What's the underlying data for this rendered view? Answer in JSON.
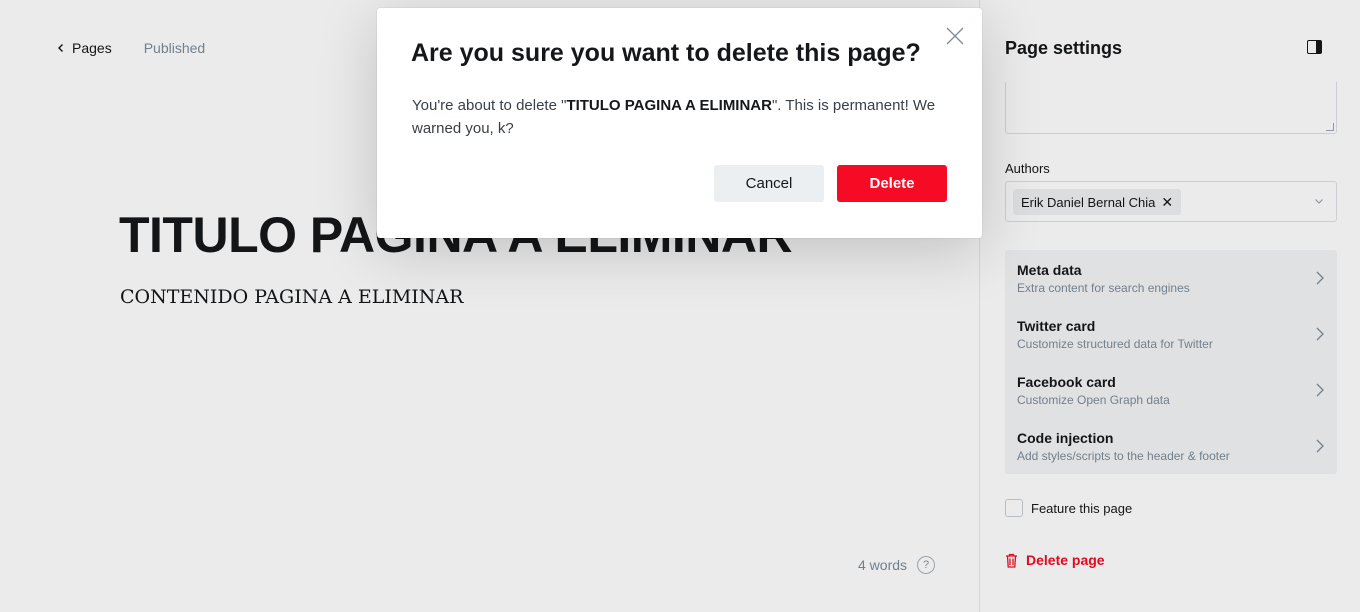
{
  "editor": {
    "back_label": "Pages",
    "status": "Published",
    "title": "TITULO PAGINA A ELIMINAR",
    "body": "CONTENIDO PAGINA A ELIMINAR",
    "word_count": "4 words",
    "help_glyph": "?"
  },
  "sidebar": {
    "header": "Page settings",
    "authors_label": "Authors",
    "author_token": "Erik Daniel Bernal Chia",
    "token_remove": "✕",
    "items": [
      {
        "title": "Meta data",
        "desc": "Extra content for search engines"
      },
      {
        "title": "Twitter card",
        "desc": "Customize structured data for Twitter"
      },
      {
        "title": "Facebook card",
        "desc": "Customize Open Graph data"
      },
      {
        "title": "Code injection",
        "desc": "Add styles/scripts to the header & footer"
      }
    ],
    "feature_label": "Feature this page",
    "delete_label": "Delete page"
  },
  "modal": {
    "title": "Are you sure you want to delete this page?",
    "text_before": "You're about to delete \"",
    "text_bold": "TITULO PAGINA A ELIMINAR",
    "text_after": "\". This is permanent! We warned you, k?",
    "cancel_label": "Cancel",
    "delete_label": "Delete"
  },
  "colors": {
    "danger": "#f50b23",
    "text": "#15171a",
    "muted": "#7c8b9a"
  }
}
